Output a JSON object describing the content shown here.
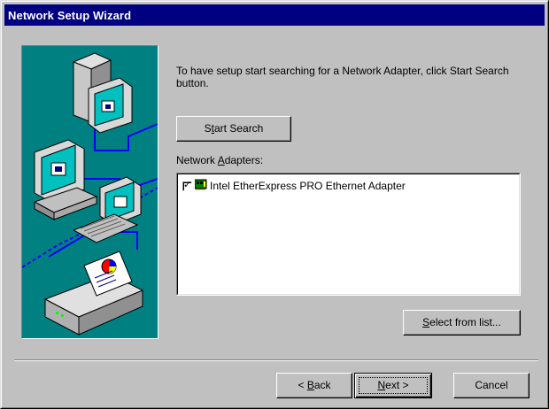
{
  "window": {
    "title": "Network Setup Wizard"
  },
  "content": {
    "instructions": "To have setup start searching for a Network Adapter, click Start Search button.",
    "start_search_prefix": "S",
    "start_search_mnemonic": "t",
    "start_search_suffix": "art Search",
    "adapters_label_prefix": "Network ",
    "adapters_label_mnemonic": "A",
    "adapters_label_suffix": "dapters:",
    "adapters": [
      {
        "checked": true,
        "icon": "network-card-icon",
        "label": "Intel EtherExpress PRO Ethernet Adapter"
      }
    ],
    "select_from_list_mnemonic": "S",
    "select_from_list_suffix": "elect from list..."
  },
  "footer": {
    "back_prefix": "< ",
    "back_mnemonic": "B",
    "back_suffix": "ack",
    "next_mnemonic": "N",
    "next_suffix": "ext >",
    "cancel_label": "Cancel"
  },
  "colors": {
    "titlebar": "#000080",
    "face": "#c0c0c0",
    "art_background": "#008080"
  }
}
